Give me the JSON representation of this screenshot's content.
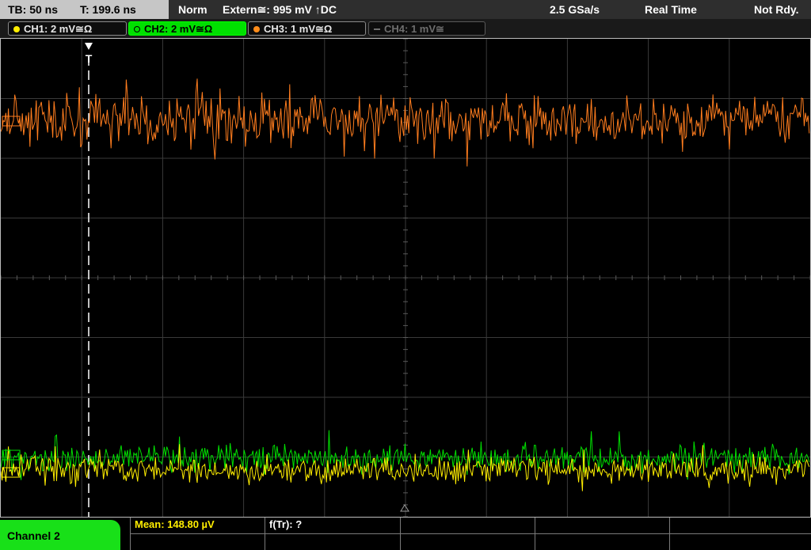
{
  "status_bar": {
    "timebase": "TB: 50 ns",
    "trigger_time": "T: 199.6 ns",
    "acq_mode": "Norm",
    "trigger": "Extern≅: 995 mV ↑DC",
    "sample_rate": "2.5 GSa/s",
    "acq_type": "Real Time",
    "trigger_state": "Not Rdy."
  },
  "channels": [
    {
      "label": "CH1: 2 mV≅Ω",
      "color": "#ffee00",
      "state": "on"
    },
    {
      "label": "CH2: 2 mV≅Ω",
      "color": "#00e000",
      "state": "selected"
    },
    {
      "label": "CH3: 1 mV≅Ω",
      "color": "#ff8c1a",
      "state": "on"
    },
    {
      "label": "CH4: 1 mV≅",
      "color": "#707070",
      "state": "off"
    }
  ],
  "display": {
    "trigger_marker": "T",
    "traces": [
      {
        "channel": "CH3",
        "color": "#ff7d1e"
      },
      {
        "channel": "CH2",
        "color": "#00e000"
      },
      {
        "channel": "CH1",
        "color": "#ffee00"
      }
    ]
  },
  "bottom": {
    "selected_channel_tab": "Channel 2",
    "measurements": {
      "mean": "Mean: 148.80 µV",
      "ftr": "f(Tr): ?"
    }
  }
}
